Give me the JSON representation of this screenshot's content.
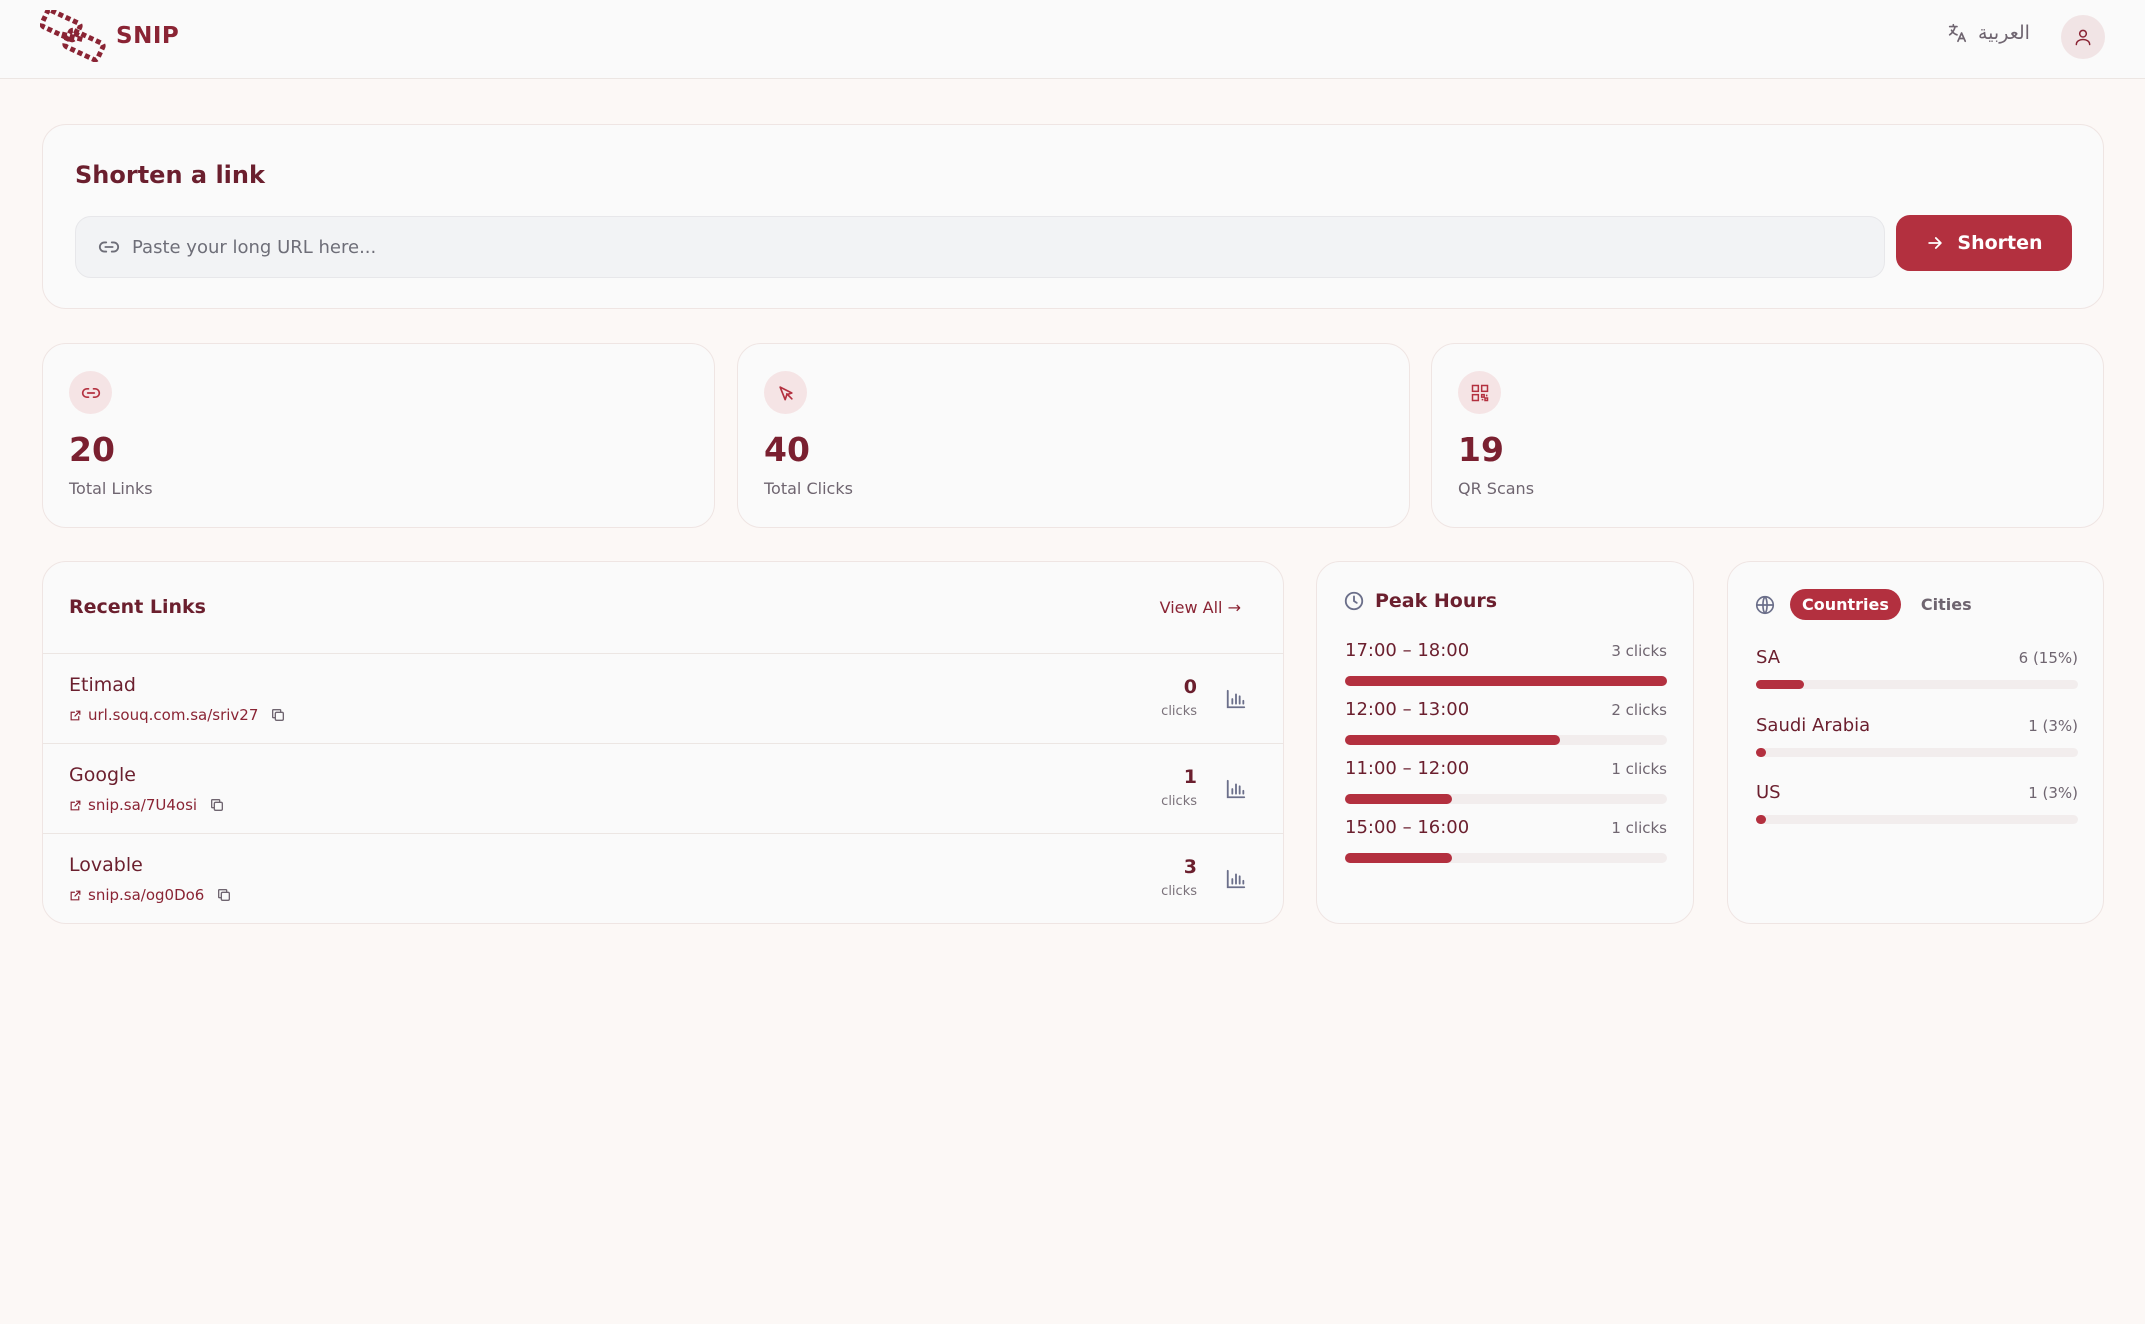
{
  "header": {
    "brand": "SNIP",
    "language_label": "العربية",
    "icons": {
      "logo": "chain-link-logo",
      "language": "translate-icon",
      "avatar": "user-icon"
    }
  },
  "shorten": {
    "title": "Shorten a link",
    "placeholder": "Paste your long URL here...",
    "value": "",
    "button_label": "Shorten"
  },
  "stats": [
    {
      "value": "20",
      "label": "Total Links",
      "icon": "link-icon"
    },
    {
      "value": "40",
      "label": "Total Clicks",
      "icon": "cursor-icon"
    },
    {
      "value": "19",
      "label": "QR Scans",
      "icon": "qr-icon"
    }
  ],
  "recent_links": {
    "title": "Recent Links",
    "view_all": "View All →",
    "items": [
      {
        "name": "Etimad",
        "url": "url.souq.com.sa/sriv27",
        "clicks": "0",
        "clicks_label": "clicks"
      },
      {
        "name": "Google",
        "url": "snip.sa/7U4osi",
        "clicks": "1",
        "clicks_label": "clicks"
      },
      {
        "name": "Lovable",
        "url": "snip.sa/og0Do6",
        "clicks": "3",
        "clicks_label": "clicks"
      }
    ]
  },
  "peak_hours": {
    "title": "Peak Hours",
    "items": [
      {
        "range": "17:00 – 18:00",
        "clicks": "3 clicks",
        "fraction": 1.0
      },
      {
        "range": "12:00 – 13:00",
        "clicks": "2 clicks",
        "fraction": 0.667
      },
      {
        "range": "11:00 – 12:00",
        "clicks": "1 clicks",
        "fraction": 0.333
      },
      {
        "range": "15:00 – 16:00",
        "clicks": "1 clicks",
        "fraction": 0.333
      }
    ]
  },
  "geo": {
    "tabs": {
      "active": "Countries",
      "inactive": "Cities"
    },
    "items": [
      {
        "name": "SA",
        "value": "6 (15%)",
        "fraction": 0.15
      },
      {
        "name": "Saudi Arabia",
        "value": "1 (3%)",
        "fraction": 0.03
      },
      {
        "name": "US",
        "value": "1 (3%)",
        "fraction": 0.03
      }
    ]
  },
  "colors": {
    "accent": "#b3303f",
    "brand_text": "#6b1f2e",
    "background": "#fcf8f6"
  }
}
